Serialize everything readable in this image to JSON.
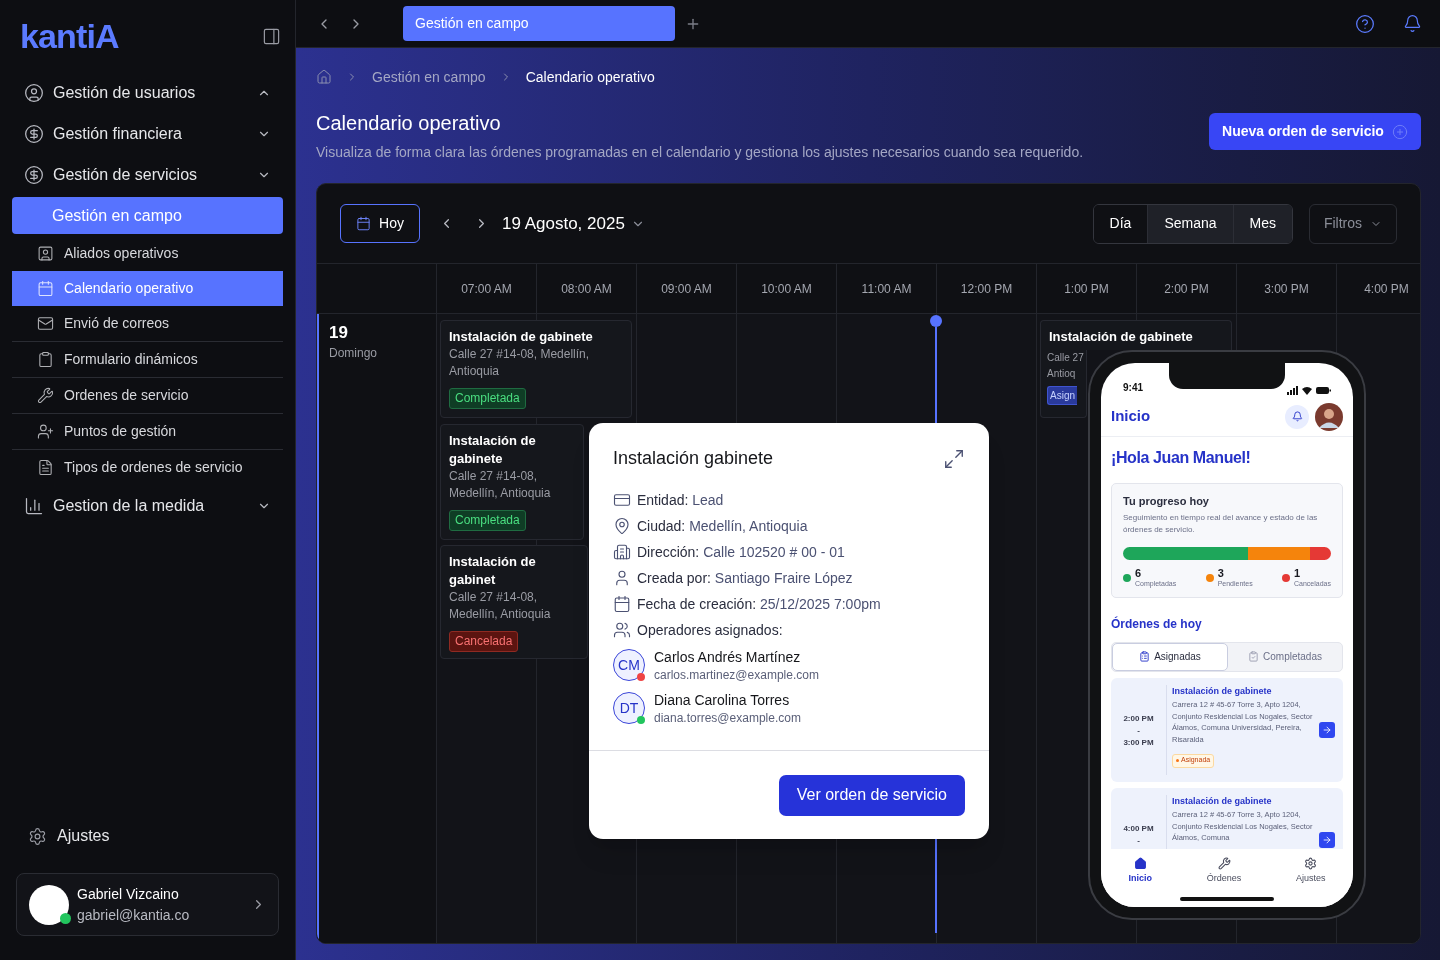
{
  "sidebar": {
    "logo": "kantiA",
    "nav": [
      {
        "kind": "group",
        "label": "Gestión de usuarios",
        "expanded": true
      },
      {
        "kind": "group",
        "label": "Gestión financiera",
        "expanded": false
      },
      {
        "kind": "group",
        "label": "Gestión de servicios",
        "expanded": false
      },
      {
        "kind": "section",
        "label": "Gestión en campo",
        "selected": true
      },
      {
        "kind": "item",
        "label": "Aliados operativos",
        "selected": false
      },
      {
        "kind": "item",
        "label": "Calendario operativo",
        "selected": true
      },
      {
        "kind": "item",
        "label": "Envió de correos",
        "selected": false
      },
      {
        "kind": "item",
        "label": "Formulario dinámicos",
        "selected": false
      },
      {
        "kind": "item",
        "label": "Ordenes de servicio",
        "selected": false
      },
      {
        "kind": "item",
        "label": "Puntos de gestión",
        "selected": false
      },
      {
        "kind": "item",
        "label": "Tipos de ordenes de servicio",
        "selected": false
      },
      {
        "kind": "group",
        "label": "Gestion de la medida",
        "expanded": false
      }
    ],
    "settings": "Ajustes",
    "user": {
      "name": "Gabriel Vizcaino",
      "email": "gabriel@kantia.co",
      "color": "#22c55e"
    }
  },
  "topbar": {
    "tabs": [
      {
        "label": "Gestión en campo",
        "selected": true
      }
    ]
  },
  "breadcrumb": [
    "Gestión en campo",
    "Calendario operativo"
  ],
  "page": {
    "title": "Calendario operativo",
    "subtitle": "Visualiza de forma clara las órdenes programadas en el calendario y gestiona los ajustes necesarios cuando sea requerido.",
    "primary_button": "Nueva orden de servicio"
  },
  "calendar": {
    "today_button": "Hoy",
    "date": "19 Agosto, 2025",
    "views": [
      {
        "label": "Día",
        "selected": true
      },
      {
        "label": "Semana",
        "selected": false
      },
      {
        "label": "Mes",
        "selected": false
      }
    ],
    "filter": "Filtros",
    "hours": [
      "07:00 AM",
      "08:00 AM",
      "09:00 AM",
      "10:00 AM",
      "11:00 AM",
      "12:00 PM",
      "1:00 PM",
      "2:00 PM",
      "3:00 PM",
      "4:00 PM"
    ],
    "day": {
      "number": "19",
      "weekday": "Domingo"
    },
    "events": [
      {
        "title": "Instalación de gabinete",
        "address": "Calle 27 #14-08, Medellín, Antioquia",
        "status": "Completada",
        "kind": "completed"
      },
      {
        "title": "Instalación de gabinete",
        "address": "Calle 27 #14-08, Medellín, Antioquia",
        "status": "Completada",
        "kind": "completed"
      },
      {
        "title": "Instalación de gabinet",
        "address": "Calle 27 #14-08, Medellín, Antioquia",
        "status": "Cancelada",
        "kind": "cancelled"
      },
      {
        "title": "Instalación de gabinete",
        "address": "Calle 27 Antioq",
        "status": "Asign",
        "kind": "assigned"
      }
    ]
  },
  "popover": {
    "title": "Instalación gabinete",
    "fields": [
      {
        "label": "Entidad:",
        "value": "Lead"
      },
      {
        "label": "Ciudad:",
        "value": "Medellín, Antioquia"
      },
      {
        "label": "Dirección:",
        "value": "Calle 102520 # 00 - 01"
      },
      {
        "label": "Creada por:",
        "value": "Santiago Fraire López"
      },
      {
        "label": "Fecha de creación:",
        "value": "25/12/2025 7:00pm"
      }
    ],
    "operators_label": "Operadores asignados:",
    "operators": [
      {
        "initials": "CM",
        "name": "Carlos Andrés Martínez",
        "email": "carlos.martinez@example.com",
        "color": "#ef4444"
      },
      {
        "initials": "DT",
        "name": "Diana Carolina Torres",
        "email": "diana.torres@example.com",
        "color": "#22c55e"
      }
    ],
    "button": "Ver orden de servicio"
  },
  "phone": {
    "time": "9:41",
    "header": "Inicio",
    "greeting": "¡Hola Juan Manuel!",
    "progress": {
      "title": "Tu progreso hoy",
      "description": "Seguimiento en tiempo real del avance y estado de las órdenes de servicio.",
      "stats": [
        {
          "count": "6",
          "label": "Completadas",
          "color": "#1ea65a"
        },
        {
          "count": "3",
          "label": "Pendientes",
          "color": "#f5840c"
        },
        {
          "count": "1",
          "label": "Canceladas",
          "color": "#e53935"
        }
      ]
    },
    "orders_title": "Órdenes de hoy",
    "tabs": [
      {
        "label": "Asignadas",
        "selected": true
      },
      {
        "label": "Completadas",
        "selected": false
      }
    ],
    "orders": [
      {
        "start": "2:00 PM",
        "separator": "-",
        "end": "3:00 PM",
        "title": "Instalación de gabinete",
        "address": "Carrera 12 # 45-67 Torre 3, Apto 1204, Conjunto Residencial Los Nogales, Sector Álamos, Comuna Universidad, Pereira, Risaralda",
        "status": "Asignada"
      },
      {
        "start": "4:00 PM",
        "separator": "-",
        "title": "Instalación de gabinete",
        "address": "Carrera 12 # 45-67 Torre 3, Apto 1204, Conjunto Residencial Los Nogales, Sector Álamos, Comuna"
      }
    ],
    "nav": [
      {
        "label": "Inicio",
        "selected": true
      },
      {
        "label": "Órdenes",
        "selected": false
      },
      {
        "label": "Ajustes",
        "selected": false
      }
    ]
  }
}
